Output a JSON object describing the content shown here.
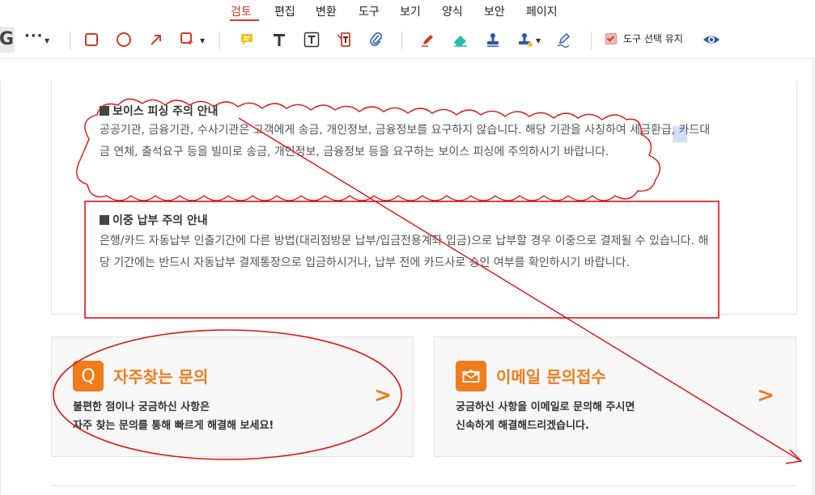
{
  "menu": {
    "items": [
      {
        "label": "검토",
        "active": true
      },
      {
        "label": "편집"
      },
      {
        "label": "변환"
      },
      {
        "label": "도구"
      },
      {
        "label": "보기"
      },
      {
        "label": "양식"
      },
      {
        "label": "보안"
      },
      {
        "label": "페이지"
      }
    ]
  },
  "toolbar": {
    "partial_letter": "G",
    "more": "···",
    "keep_tool_label": "도구 선택 유지",
    "keep_tool_checked": true,
    "icons": [
      "rectangle-icon",
      "ellipse-icon",
      "arrow-icon",
      "stamp-shape-icon",
      "sticky-note-icon",
      "text-icon",
      "textbox-icon",
      "callout-icon",
      "attach-icon",
      "pencil-icon",
      "eraser-icon",
      "stamp-icon",
      "stamp-dropdown-icon",
      "sign-icon",
      "eye-icon"
    ],
    "accent": "#d13a2a"
  },
  "notice1": {
    "heading": "보이스 피싱 주의 안내",
    "body": "공공기관, 금융기관, 수사기관은 고객에게 송금, 개인정보, 금융정보를 요구하지 않습니다. 해당 기관을 사칭하여 세금환급, 카드대금 연체, 출석요구 등을 빌미로 송금, 개인정보, 금융정보 등을 요구하는 보이스 피싱에 주의하시기 바랍니다."
  },
  "notice2": {
    "heading": "이중 납부 주의 안내",
    "body": "은행/카드 자동납부 인출기간에 다른 방법(대리점방문 납부/입금전용계좌 입금)으로 납부할 경우 이중으로 결제될 수 있습니다. 해당 기간에는 반드시 자동납부 결제통장으로 입금하시거나, 납부 전에 카드사로 승인 여부를 확인하시기 바랍니다."
  },
  "cards": [
    {
      "icon_letter": "Q",
      "title": "자주찾는 문의",
      "line1": "불편한 점이나 궁금하신 사항은",
      "line2": "자주 찾는 문의를 통해 빠르게 해결해 보세요!",
      "arrow": ">"
    },
    {
      "icon": "envelope-icon",
      "title": "이메일 문의접수",
      "line1": "궁금하신 사항을 이메일로 문의해 주시면",
      "line2": "신속하게 해결해드리겠습니다.",
      "arrow": ">"
    }
  ],
  "colors": {
    "brand_orange": "#f07c1c",
    "annotation_red": "#e01010"
  }
}
